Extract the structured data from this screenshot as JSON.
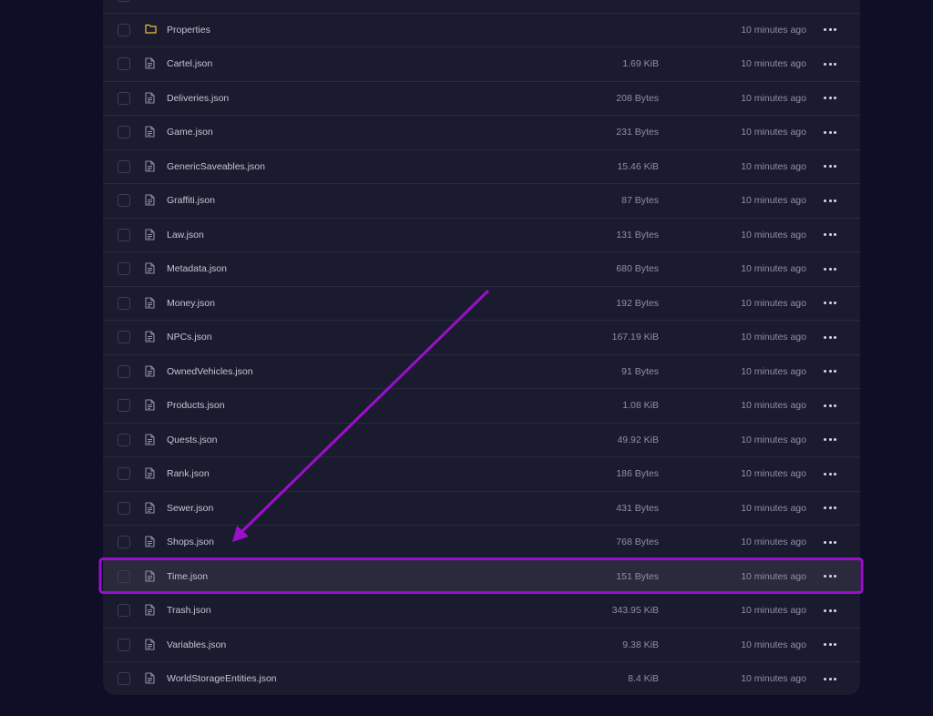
{
  "rows": [
    {
      "name": "",
      "size": "",
      "modified": "",
      "type": "folder"
    },
    {
      "name": "Properties",
      "size": "",
      "modified": "10 minutes ago",
      "type": "folder"
    },
    {
      "name": "Cartel.json",
      "size": "1.69 KiB",
      "modified": "10 minutes ago",
      "type": "file"
    },
    {
      "name": "Deliveries.json",
      "size": "208 Bytes",
      "modified": "10 minutes ago",
      "type": "file"
    },
    {
      "name": "Game.json",
      "size": "231 Bytes",
      "modified": "10 minutes ago",
      "type": "file"
    },
    {
      "name": "GenericSaveables.json",
      "size": "15.46 KiB",
      "modified": "10 minutes ago",
      "type": "file"
    },
    {
      "name": "Graffiti.json",
      "size": "87 Bytes",
      "modified": "10 minutes ago",
      "type": "file"
    },
    {
      "name": "Law.json",
      "size": "131 Bytes",
      "modified": "10 minutes ago",
      "type": "file"
    },
    {
      "name": "Metadata.json",
      "size": "680 Bytes",
      "modified": "10 minutes ago",
      "type": "file"
    },
    {
      "name": "Money.json",
      "size": "192 Bytes",
      "modified": "10 minutes ago",
      "type": "file"
    },
    {
      "name": "NPCs.json",
      "size": "167.19 KiB",
      "modified": "10 minutes ago",
      "type": "file"
    },
    {
      "name": "OwnedVehicles.json",
      "size": "91 Bytes",
      "modified": "10 minutes ago",
      "type": "file"
    },
    {
      "name": "Products.json",
      "size": "1.08 KiB",
      "modified": "10 minutes ago",
      "type": "file"
    },
    {
      "name": "Quests.json",
      "size": "49.92 KiB",
      "modified": "10 minutes ago",
      "type": "file"
    },
    {
      "name": "Rank.json",
      "size": "186 Bytes",
      "modified": "10 minutes ago",
      "type": "file"
    },
    {
      "name": "Sewer.json",
      "size": "431 Bytes",
      "modified": "10 minutes ago",
      "type": "file"
    },
    {
      "name": "Shops.json",
      "size": "768 Bytes",
      "modified": "10 minutes ago",
      "type": "file"
    },
    {
      "name": "Time.json",
      "size": "151 Bytes",
      "modified": "10 minutes ago",
      "type": "file",
      "highlighted": true
    },
    {
      "name": "Trash.json",
      "size": "343.95 KiB",
      "modified": "10 minutes ago",
      "type": "file"
    },
    {
      "name": "Variables.json",
      "size": "9.38 KiB",
      "modified": "10 minutes ago",
      "type": "file"
    },
    {
      "name": "WorldStorageEntities.json",
      "size": "8.4 KiB",
      "modified": "10 minutes ago",
      "type": "file"
    }
  ],
  "icons": {
    "folder": "folder-icon",
    "file": "file-text-icon",
    "more": "more-horizontal-icon"
  },
  "colors": {
    "background": "#0e0e27",
    "panel": "#1b1b2f",
    "row_highlight": "#2a2a3c",
    "annotation": "#9b0fcc",
    "folder": "#e8c43a"
  }
}
